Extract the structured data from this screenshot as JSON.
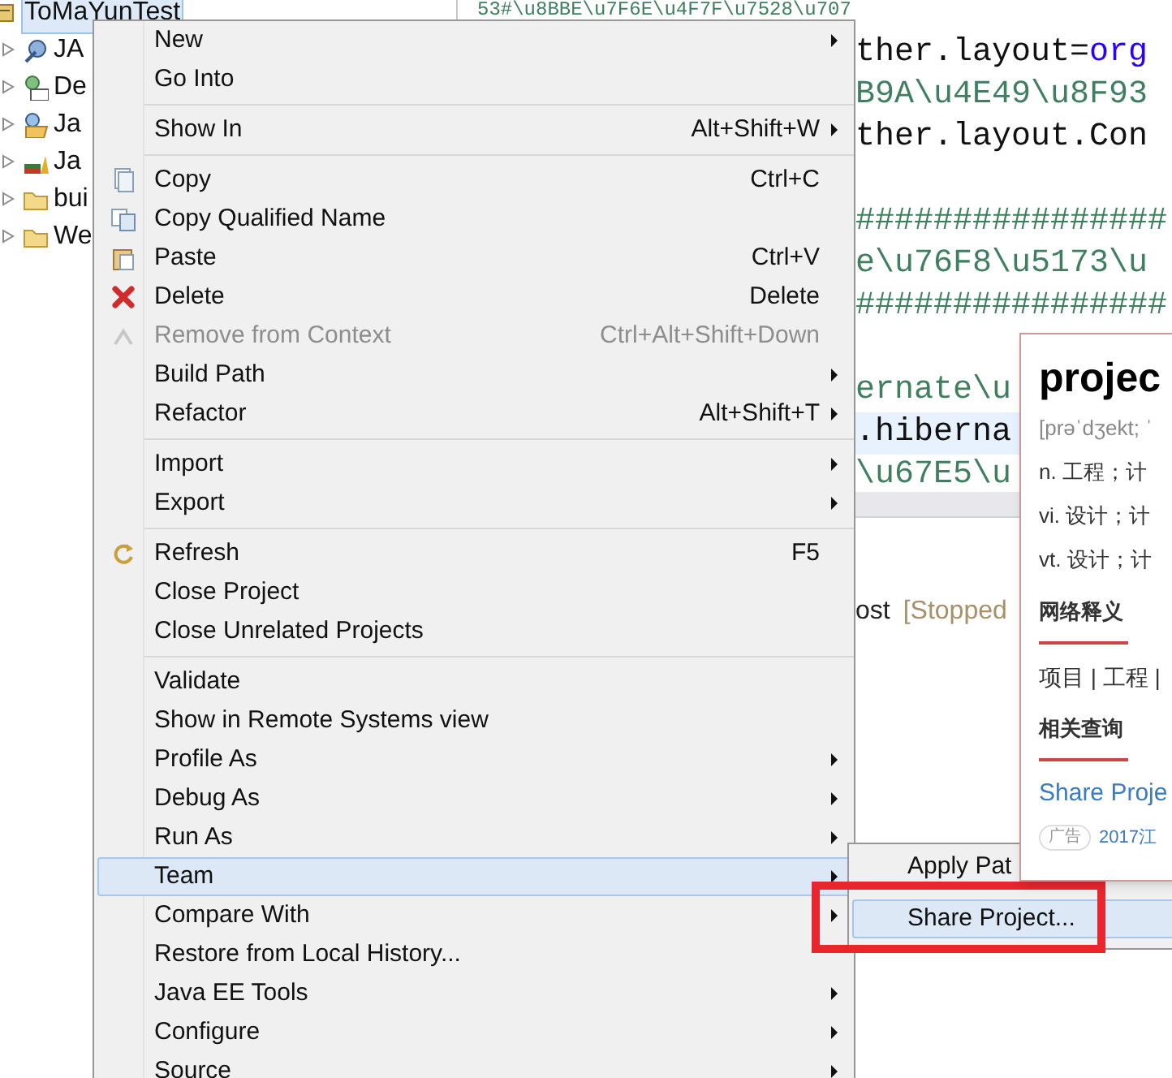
{
  "project_tree": [
    {
      "label": "ToMaYunTest",
      "selected": true
    },
    {
      "label": "JA",
      "selected": false
    },
    {
      "label": "De",
      "selected": false
    },
    {
      "label": "Ja",
      "selected": false
    },
    {
      "label": "Ja",
      "selected": false
    },
    {
      "label": "bui",
      "selected": false
    },
    {
      "label": "We",
      "selected": false
    }
  ],
  "editor": {
    "lines": [
      {
        "highlighted": false,
        "segments": [
          {
            "text": "53#\\u8BBE\\u7F6E\\u4F7F\\u7528\\u707",
            "kind": "comment"
          }
        ]
      },
      {
        "highlighted": false,
        "segments": [
          {
            "text": "ther.layout=",
            "kind": "key"
          },
          {
            "text": "org",
            "kind": "value"
          }
        ]
      },
      {
        "highlighted": false,
        "segments": [
          {
            "text": "B9A\\u4E49\\u8F93",
            "kind": "comment"
          }
        ]
      },
      {
        "highlighted": false,
        "segments": [
          {
            "text": "ther.layout.Con",
            "kind": "key"
          }
        ]
      },
      {
        "highlighted": false
      },
      {
        "highlighted": false,
        "segments": [
          {
            "text": "################",
            "kind": "comment"
          }
        ]
      },
      {
        "highlighted": false,
        "segments": [
          {
            "text": "e\\u76F8\\u5173\\u",
            "kind": "comment"
          }
        ]
      },
      {
        "highlighted": false,
        "segments": [
          {
            "text": "################",
            "kind": "comment"
          }
        ]
      },
      {
        "highlighted": false
      },
      {
        "highlighted": false,
        "segments": [
          {
            "text": "ernate\\u",
            "kind": "comment"
          }
        ]
      },
      {
        "highlighted": true,
        "segments": [
          {
            "text": ".hiberna",
            "kind": "key"
          }
        ]
      },
      {
        "highlighted": false,
        "segments": [
          {
            "text": "\\u67E5\\u",
            "kind": "comment"
          }
        ]
      }
    ]
  },
  "console": {
    "text": "ost",
    "status": "[Stopped"
  },
  "context_menu": {
    "groups": [
      [
        {
          "label": "New",
          "submenu": true,
          "disabled": false,
          "selected": false
        },
        {
          "label": "Go Into",
          "submenu": false,
          "disabled": false,
          "selected": false
        }
      ],
      [
        {
          "label": "Show In",
          "shortcut": "Alt+Shift+W",
          "submenu": true,
          "disabled": false,
          "selected": false
        }
      ],
      [
        {
          "label": "Copy",
          "shortcut": "Ctrl+C",
          "submenu": false,
          "disabled": false,
          "selected": false
        },
        {
          "label": "Copy Qualified Name",
          "submenu": false,
          "disabled": false,
          "selected": false
        },
        {
          "label": "Paste",
          "shortcut": "Ctrl+V",
          "submenu": false,
          "disabled": false,
          "selected": false
        },
        {
          "label": "Delete",
          "shortcut": "Delete",
          "submenu": false,
          "disabled": false,
          "selected": false
        },
        {
          "label": "Remove from Context",
          "shortcut": "Ctrl+Alt+Shift+Down",
          "submenu": false,
          "disabled": true,
          "selected": false
        },
        {
          "label": "Build Path",
          "submenu": true,
          "disabled": false,
          "selected": false
        },
        {
          "label": "Refactor",
          "shortcut": "Alt+Shift+T",
          "submenu": true,
          "disabled": false,
          "selected": false
        }
      ],
      [
        {
          "label": "Import",
          "submenu": true,
          "disabled": false,
          "selected": false
        },
        {
          "label": "Export",
          "submenu": true,
          "disabled": false,
          "selected": false
        }
      ],
      [
        {
          "label": "Refresh",
          "shortcut": "F5",
          "submenu": false,
          "disabled": false,
          "selected": false
        },
        {
          "label": "Close Project",
          "submenu": false,
          "disabled": false,
          "selected": false
        },
        {
          "label": "Close Unrelated Projects",
          "submenu": false,
          "disabled": false,
          "selected": false
        }
      ],
      [
        {
          "label": "Validate",
          "submenu": false,
          "disabled": false,
          "selected": false
        },
        {
          "label": "Show in Remote Systems view",
          "submenu": false,
          "disabled": false,
          "selected": false
        },
        {
          "label": "Profile As",
          "submenu": true,
          "disabled": false,
          "selected": false
        },
        {
          "label": "Debug As",
          "submenu": true,
          "disabled": false,
          "selected": false
        },
        {
          "label": "Run As",
          "submenu": true,
          "disabled": false,
          "selected": false
        },
        {
          "label": "Team",
          "submenu": true,
          "disabled": false,
          "selected": true
        },
        {
          "label": "Compare With",
          "submenu": true,
          "disabled": false,
          "selected": false
        },
        {
          "label": "Restore from Local History...",
          "submenu": false,
          "disabled": false,
          "selected": false
        },
        {
          "label": "Java EE Tools",
          "submenu": true,
          "disabled": false,
          "selected": false
        },
        {
          "label": "Configure",
          "submenu": true,
          "disabled": false,
          "selected": false
        },
        {
          "label": "Source",
          "submenu": true,
          "disabled": false,
          "selected": false
        }
      ]
    ]
  },
  "team_submenu": [
    {
      "label": "Apply Pat",
      "selected": false
    },
    {
      "label": "Share Project...",
      "selected": true
    }
  ],
  "dictionary_popup": {
    "word": "projec",
    "phonetic": "[prəˈdʒekt; ˈ",
    "senses": [
      "n. 工程；计",
      "vi. 设计；计",
      "vt. 设计；计"
    ],
    "web_heading": "网络释义",
    "web_text": "项目 | 工程 |",
    "related_heading": "相关查询",
    "related_link": "Share Proje",
    "ad_tag": "广告",
    "ad_text": "2017江"
  }
}
